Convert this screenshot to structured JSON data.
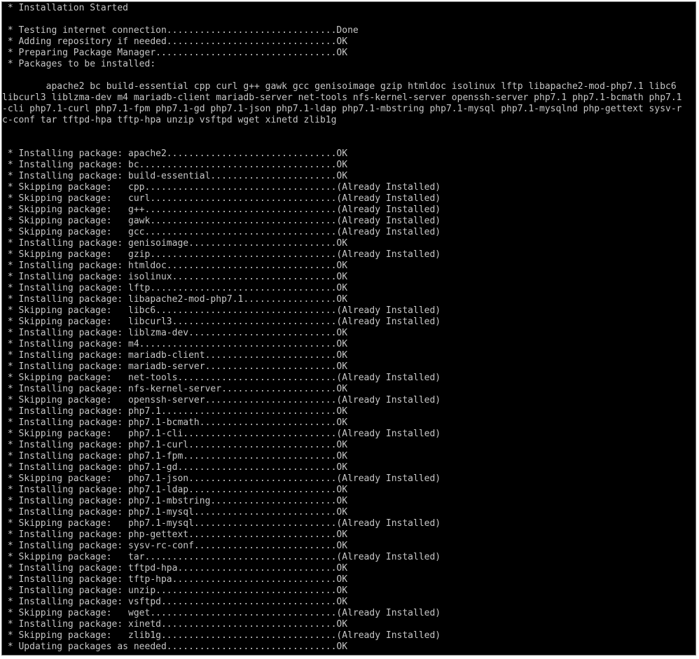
{
  "terminal": {
    "colors": {
      "background": "#000000",
      "foreground": "#c6c6c6"
    },
    "lines": [
      " * Installation Started",
      "",
      " * Testing internet connection...............................Done",
      " * Adding repository if needed...............................OK",
      " * Preparing Package Manager.................................OK",
      " * Packages to be installed:",
      "",
      "        apache2 bc build-essential cpp curl g++ gawk gcc genisoimage gzip htmldoc isolinux lftp libapache2-mod-php7.1 libc6",
      "libcurl3 liblzma-dev m4 mariadb-client mariadb-server net-tools nfs-kernel-server openssh-server php7.1 php7.1-bcmath php7.1",
      "-cli php7.1-curl php7.1-fpm php7.1-gd php7.1-json php7.1-ldap php7.1-mbstring php7.1-mysql php7.1-mysqlnd php-gettext sysv-r",
      "c-conf tar tftpd-hpa tftp-hpa unzip vsftpd wget xinetd zlib1g",
      "",
      "",
      " * Installing package: apache2...............................OK",
      " * Installing package: bc....................................OK",
      " * Installing package: build-essential.......................OK",
      " * Skipping package:   cpp...................................(Already Installed)",
      " * Skipping package:   curl..................................(Already Installed)",
      " * Skipping package:   g++...................................(Already Installed)",
      " * Skipping package:   gawk..................................(Already Installed)",
      " * Skipping package:   gcc...................................(Already Installed)",
      " * Installing package: genisoimage...........................OK",
      " * Skipping package:   gzip..................................(Already Installed)",
      " * Installing package: htmldoc...............................OK",
      " * Installing package: isolinux..............................OK",
      " * Installing package: lftp..................................OK",
      " * Installing package: libapache2-mod-php7.1.................OK",
      " * Skipping package:   libc6.................................(Already Installed)",
      " * Skipping package:   libcurl3..............................(Already Installed)",
      " * Installing package: liblzma-dev...........................OK",
      " * Installing package: m4....................................OK",
      " * Installing package: mariadb-client........................OK",
      " * Installing package: mariadb-server........................OK",
      " * Skipping package:   net-tools.............................(Already Installed)",
      " * Installing package: nfs-kernel-server.....................OK",
      " * Skipping package:   openssh-server........................(Already Installed)",
      " * Installing package: php7.1................................OK",
      " * Installing package: php7.1-bcmath.........................OK",
      " * Skipping package:   php7.1-cli............................(Already Installed)",
      " * Installing package: php7.1-curl...........................OK",
      " * Installing package: php7.1-fpm............................OK",
      " * Installing package: php7.1-gd.............................OK",
      " * Skipping package:   php7.1-json...........................(Already Installed)",
      " * Installing package: php7.1-ldap...........................OK",
      " * Installing package: php7.1-mbstring.......................OK",
      " * Installing package: php7.1-mysql..........................OK",
      " * Skipping package:   php7.1-mysql..........................(Already Installed)",
      " * Installing package: php-gettext...........................OK",
      " * Installing package: sysv-rc-conf..........................OK",
      " * Skipping package:   tar...................................(Already Installed)",
      " * Installing package: tftpd-hpa.............................OK",
      " * Installing package: tftp-hpa..............................OK",
      " * Installing package: unzip.................................OK",
      " * Installing package: vsftpd................................OK",
      " * Skipping package:   wget..................................(Already Installed)",
      " * Installing package: xinetd................................OK",
      " * Skipping package:   zlib1g................................(Already Installed)",
      " * Updating packages as needed...............................OK"
    ]
  }
}
